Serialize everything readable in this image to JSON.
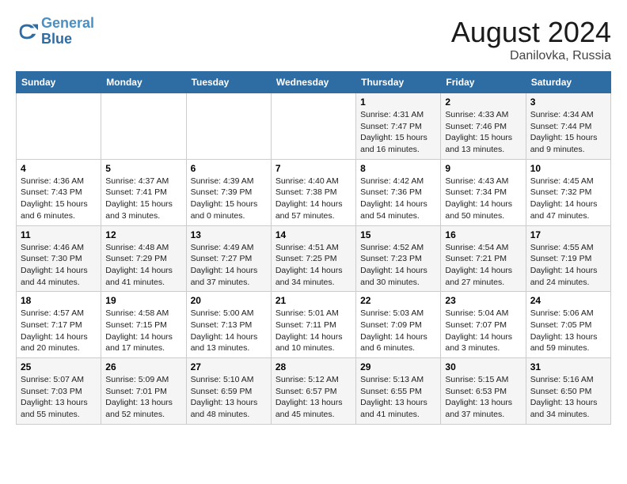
{
  "header": {
    "logo_line1": "General",
    "logo_line2": "Blue",
    "month_year": "August 2024",
    "location": "Danilovka, Russia"
  },
  "days_of_week": [
    "Sunday",
    "Monday",
    "Tuesday",
    "Wednesday",
    "Thursday",
    "Friday",
    "Saturday"
  ],
  "weeks": [
    [
      {
        "num": "",
        "info": ""
      },
      {
        "num": "",
        "info": ""
      },
      {
        "num": "",
        "info": ""
      },
      {
        "num": "",
        "info": ""
      },
      {
        "num": "1",
        "info": "Sunrise: 4:31 AM\nSunset: 7:47 PM\nDaylight: 15 hours\nand 16 minutes."
      },
      {
        "num": "2",
        "info": "Sunrise: 4:33 AM\nSunset: 7:46 PM\nDaylight: 15 hours\nand 13 minutes."
      },
      {
        "num": "3",
        "info": "Sunrise: 4:34 AM\nSunset: 7:44 PM\nDaylight: 15 hours\nand 9 minutes."
      }
    ],
    [
      {
        "num": "4",
        "info": "Sunrise: 4:36 AM\nSunset: 7:43 PM\nDaylight: 15 hours\nand 6 minutes."
      },
      {
        "num": "5",
        "info": "Sunrise: 4:37 AM\nSunset: 7:41 PM\nDaylight: 15 hours\nand 3 minutes."
      },
      {
        "num": "6",
        "info": "Sunrise: 4:39 AM\nSunset: 7:39 PM\nDaylight: 15 hours\nand 0 minutes."
      },
      {
        "num": "7",
        "info": "Sunrise: 4:40 AM\nSunset: 7:38 PM\nDaylight: 14 hours\nand 57 minutes."
      },
      {
        "num": "8",
        "info": "Sunrise: 4:42 AM\nSunset: 7:36 PM\nDaylight: 14 hours\nand 54 minutes."
      },
      {
        "num": "9",
        "info": "Sunrise: 4:43 AM\nSunset: 7:34 PM\nDaylight: 14 hours\nand 50 minutes."
      },
      {
        "num": "10",
        "info": "Sunrise: 4:45 AM\nSunset: 7:32 PM\nDaylight: 14 hours\nand 47 minutes."
      }
    ],
    [
      {
        "num": "11",
        "info": "Sunrise: 4:46 AM\nSunset: 7:30 PM\nDaylight: 14 hours\nand 44 minutes."
      },
      {
        "num": "12",
        "info": "Sunrise: 4:48 AM\nSunset: 7:29 PM\nDaylight: 14 hours\nand 41 minutes."
      },
      {
        "num": "13",
        "info": "Sunrise: 4:49 AM\nSunset: 7:27 PM\nDaylight: 14 hours\nand 37 minutes."
      },
      {
        "num": "14",
        "info": "Sunrise: 4:51 AM\nSunset: 7:25 PM\nDaylight: 14 hours\nand 34 minutes."
      },
      {
        "num": "15",
        "info": "Sunrise: 4:52 AM\nSunset: 7:23 PM\nDaylight: 14 hours\nand 30 minutes."
      },
      {
        "num": "16",
        "info": "Sunrise: 4:54 AM\nSunset: 7:21 PM\nDaylight: 14 hours\nand 27 minutes."
      },
      {
        "num": "17",
        "info": "Sunrise: 4:55 AM\nSunset: 7:19 PM\nDaylight: 14 hours\nand 24 minutes."
      }
    ],
    [
      {
        "num": "18",
        "info": "Sunrise: 4:57 AM\nSunset: 7:17 PM\nDaylight: 14 hours\nand 20 minutes."
      },
      {
        "num": "19",
        "info": "Sunrise: 4:58 AM\nSunset: 7:15 PM\nDaylight: 14 hours\nand 17 minutes."
      },
      {
        "num": "20",
        "info": "Sunrise: 5:00 AM\nSunset: 7:13 PM\nDaylight: 14 hours\nand 13 minutes."
      },
      {
        "num": "21",
        "info": "Sunrise: 5:01 AM\nSunset: 7:11 PM\nDaylight: 14 hours\nand 10 minutes."
      },
      {
        "num": "22",
        "info": "Sunrise: 5:03 AM\nSunset: 7:09 PM\nDaylight: 14 hours\nand 6 minutes."
      },
      {
        "num": "23",
        "info": "Sunrise: 5:04 AM\nSunset: 7:07 PM\nDaylight: 14 hours\nand 3 minutes."
      },
      {
        "num": "24",
        "info": "Sunrise: 5:06 AM\nSunset: 7:05 PM\nDaylight: 13 hours\nand 59 minutes."
      }
    ],
    [
      {
        "num": "25",
        "info": "Sunrise: 5:07 AM\nSunset: 7:03 PM\nDaylight: 13 hours\nand 55 minutes."
      },
      {
        "num": "26",
        "info": "Sunrise: 5:09 AM\nSunset: 7:01 PM\nDaylight: 13 hours\nand 52 minutes."
      },
      {
        "num": "27",
        "info": "Sunrise: 5:10 AM\nSunset: 6:59 PM\nDaylight: 13 hours\nand 48 minutes."
      },
      {
        "num": "28",
        "info": "Sunrise: 5:12 AM\nSunset: 6:57 PM\nDaylight: 13 hours\nand 45 minutes."
      },
      {
        "num": "29",
        "info": "Sunrise: 5:13 AM\nSunset: 6:55 PM\nDaylight: 13 hours\nand 41 minutes."
      },
      {
        "num": "30",
        "info": "Sunrise: 5:15 AM\nSunset: 6:53 PM\nDaylight: 13 hours\nand 37 minutes."
      },
      {
        "num": "31",
        "info": "Sunrise: 5:16 AM\nSunset: 6:50 PM\nDaylight: 13 hours\nand 34 minutes."
      }
    ]
  ]
}
